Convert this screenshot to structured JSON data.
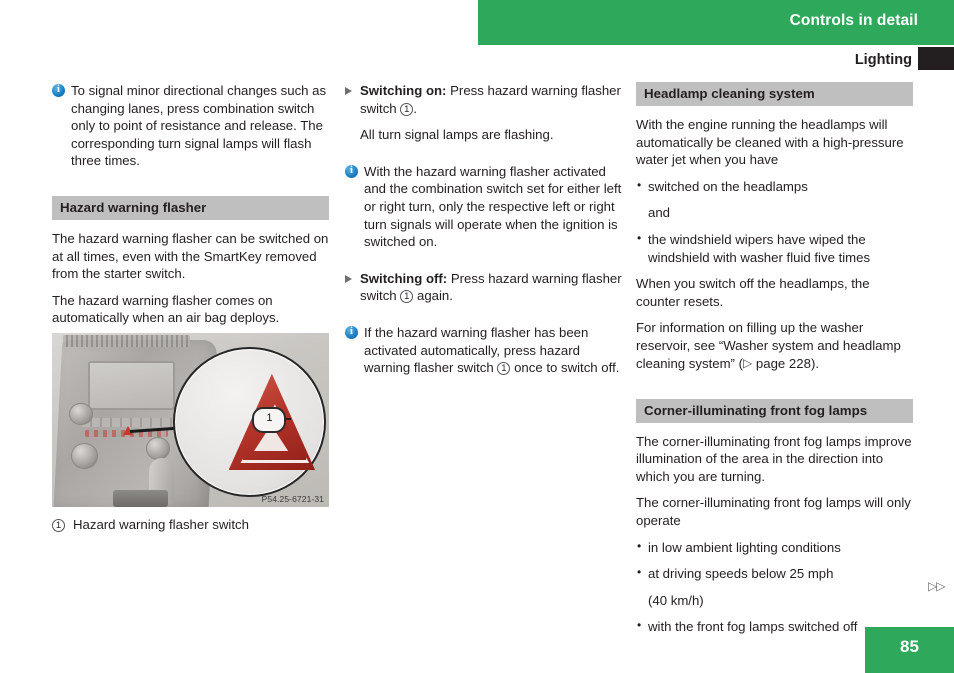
{
  "header": {
    "chapter_title": "Controls in detail",
    "section_title": "Lighting",
    "green": "#2ea85a"
  },
  "left_column": {
    "note_1": "To signal minor directional changes such as changing lanes, press combination switch only to point of resistance and release. The corresponding turn signal lamps will flash three times.",
    "heading": "Hazard warning flasher",
    "para_1": "The hazard warning flasher can be switched on at all times, even with the SmartKey removed from the starter switch.",
    "para_2": "The hazard warning flasher comes on automatically when an air bag deploys.",
    "figure": {
      "image_id": "P54.25-6721-31",
      "callout_number": "1",
      "caption_number": "1",
      "caption": "Hazard warning flasher switch"
    }
  },
  "middle_column": {
    "step_1_label": "Switching on:",
    "step_1_text_a": "Press hazard warning flasher switch",
    "step_1_ref": "1",
    "step_1_text_b": ".",
    "step_1_result": "All turn signal lamps are flashing.",
    "note_1": "With the hazard warning flasher activated and the combination switch set for either left or right turn, only the respective left or right turn signals will operate when the ignition is switched on.",
    "step_2_label": "Switching off:",
    "step_2_text_a": "Press hazard warning flasher switch",
    "step_2_ref": "1",
    "step_2_text_b": "again.",
    "note_2_a": "If the hazard warning flasher has been activated automatically, press hazard warning flasher switch",
    "note_2_ref": "1",
    "note_2_b": "once to switch off."
  },
  "right_column": {
    "heading_1": "Headlamp cleaning system",
    "para_1": "With the engine running the headlamps will automatically be cleaned with a high-pressure water jet when you have",
    "bullet_1": "switched on the headlamps",
    "bullet_1_cont": "and",
    "bullet_2": "the windshield wipers have wiped the windshield with washer fluid five times",
    "para_2": "When you switch off the headlamps, the counter resets.",
    "para_3_a": "For information on filling up the washer reservoir, see “Washer system and headlamp cleaning system” (",
    "para_3_page": "page 228",
    "para_3_b": ").",
    "heading_2": "Corner-illuminating front fog lamps",
    "para_4": "The corner-illuminating front fog lamps improve illumination of the area in the direction into which you are turning.",
    "para_5": "The corner-illuminating front fog lamps will only operate",
    "bullet_3": "in low ambient lighting conditions",
    "bullet_4": "at driving speeds below 25 mph",
    "bullet_4_cont": "(40 km/h)",
    "bullet_5": "with the front fog lamps switched off"
  },
  "footer": {
    "page_number": "85",
    "continuation_marker": "▷▷"
  }
}
